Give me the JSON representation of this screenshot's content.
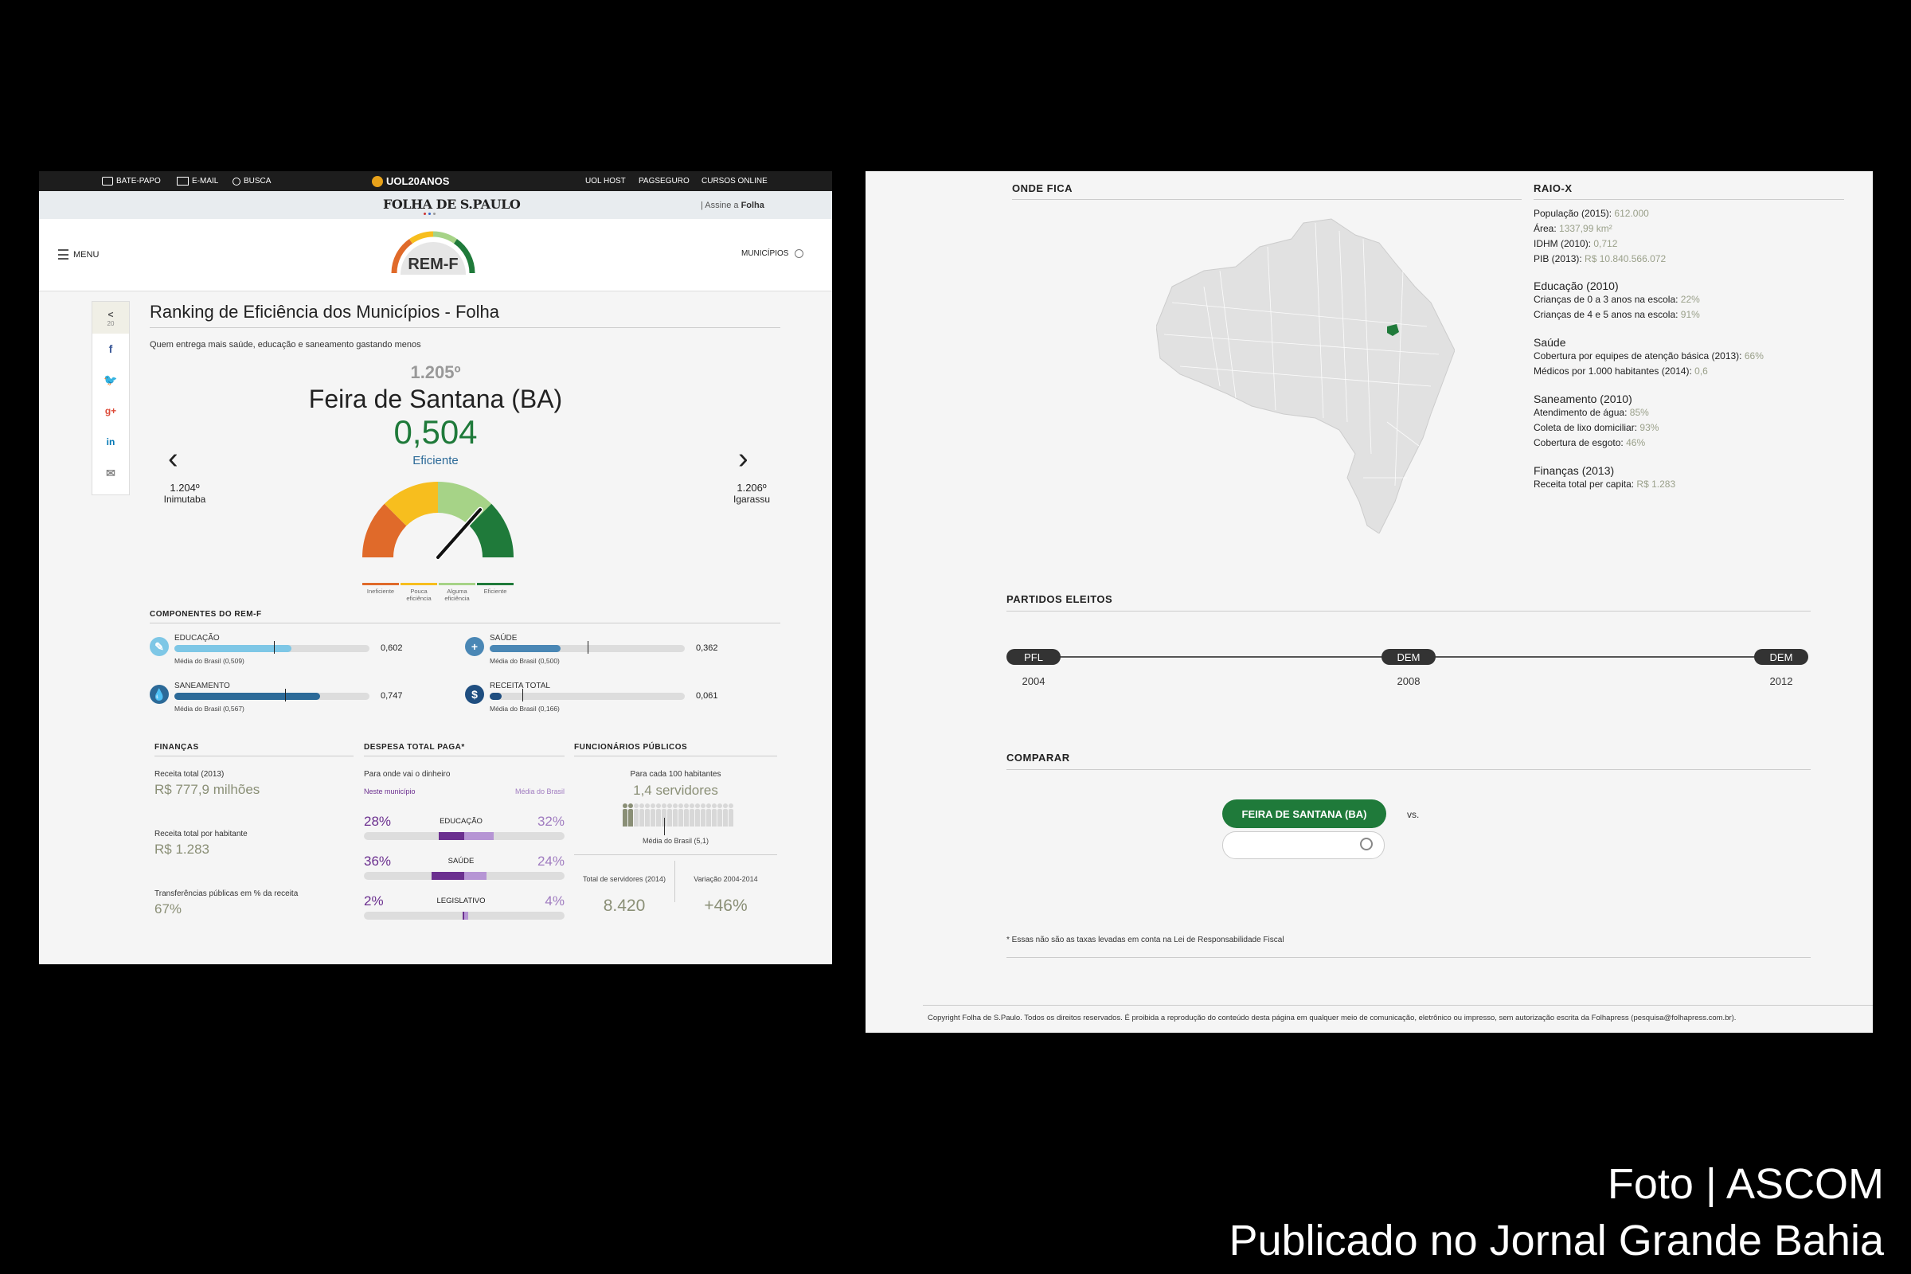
{
  "left": {
    "topbar": {
      "batepapo": "BATE-PAPO",
      "email": "E-MAIL",
      "busca": "BUSCA",
      "logo": "UOL20ANOS",
      "uolhost": "UOL HOST",
      "pagseguro": "PAGSEGURO",
      "cursos": "CURSOS ONLINE"
    },
    "folha": {
      "title": "FOLHA DE S.PAULO",
      "assine_prefix": "| Assine a",
      "assine_brand": "Folha"
    },
    "nav": {
      "menu": "MENU",
      "logo": "REM-F",
      "municipios": "MUNICÍPIOS"
    },
    "share": {
      "count": "20"
    },
    "header": {
      "title": "Ranking de Eficiência dos Municípios - Folha",
      "subtitle": "Quem entrega mais saúde, educação e saneamento gastando menos"
    },
    "city": {
      "rank": "1.205º",
      "name": "Feira de Santana (BA)",
      "score": "0,504",
      "status": "Eficiente",
      "gauge_value": 0.504,
      "prev_rank": "1.204º",
      "prev_name": "Inimutaba",
      "next_rank": "1.206º",
      "next_name": "Igarassu"
    },
    "gauge_legend": [
      {
        "label": "Ineficiente",
        "color": "#e06a2a"
      },
      {
        "label": "Pouca eficiência",
        "color": "#f7be1e"
      },
      {
        "label": "Alguma eficiência",
        "color": "#a6d387"
      },
      {
        "label": "Eficiente",
        "color": "#1f7a3a"
      }
    ],
    "components": {
      "title": "COMPONENTES DO REM-F",
      "items": [
        {
          "label": "EDUCAÇÃO",
          "value": "0,602",
          "avg": "Média do Brasil (0,509)",
          "fill": 0.602,
          "avg_pos": 0.509,
          "color": "#7ec7e6",
          "icon_color": "#7ec7e6",
          "icon": "✎"
        },
        {
          "label": "SAÚDE",
          "value": "0,362",
          "avg": "Média do Brasil (0,500)",
          "fill": 0.362,
          "avg_pos": 0.5,
          "color": "#4a87b5",
          "icon_color": "#4a87b5",
          "icon": "+"
        },
        {
          "label": "SANEAMENTO",
          "value": "0,747",
          "avg": "Média do Brasil (0,567)",
          "fill": 0.747,
          "avg_pos": 0.567,
          "color": "#2c6a98",
          "icon_color": "#2c6a98",
          "icon": "💧"
        },
        {
          "label": "RECEITA TOTAL",
          "value": "0,061",
          "avg": "Média do Brasil (0,166)",
          "fill": 0.061,
          "avg_pos": 0.166,
          "color": "#1f4e80",
          "icon_color": "#1f4e80",
          "icon": "$"
        }
      ]
    },
    "financas": {
      "title": "FINANÇAS",
      "items": [
        {
          "label": "Receita total (2013)",
          "value": "R$ 777,9 milhões"
        },
        {
          "label": "Receita total por habitante",
          "value": "R$ 1.283"
        },
        {
          "label": "Transferências públicas em % da receita",
          "value": "67%"
        }
      ]
    },
    "despesa": {
      "title": "DESPESA TOTAL PAGA*",
      "subtitle": "Para onde vai o dinheiro",
      "neste": "Neste município",
      "media": "Média do Brasil",
      "items": [
        {
          "label": "EDUCAÇÃO",
          "local": "28%",
          "brasil": "32%",
          "local_val": 0.28,
          "brasil_val": 0.32
        },
        {
          "label": "SAÚDE",
          "local": "36%",
          "brasil": "24%",
          "local_val": 0.36,
          "brasil_val": 0.24
        },
        {
          "label": "LEGISLATIVO",
          "local": "2%",
          "brasil": "4%",
          "local_val": 0.02,
          "brasil_val": 0.04
        }
      ]
    },
    "funcionarios": {
      "title": "FUNCIONÁRIOS PÚBLICOS",
      "subtitle": "Para cada 100 habitantes",
      "value": "1,4 servidores",
      "media": "Média do Brasil (5,1)",
      "total_label": "Total de servidores (2014)",
      "total_value": "8.420",
      "var_label": "Variação 2004-2014",
      "var_value": "+46%"
    }
  },
  "right": {
    "onde_fica": "ONDE FICA",
    "raio_x": {
      "title": "RAIO-X",
      "lines1": [
        {
          "label": "População (2015):",
          "value": "612.000"
        },
        {
          "label": "Área:",
          "value": "1337,99 km²"
        },
        {
          "label": "IDHM (2010):",
          "value": "0,712"
        },
        {
          "label": "PIB (2013):",
          "value": "R$ 10.840.566.072"
        }
      ],
      "educacao_title": "Educação (2010)",
      "educacao": [
        {
          "label": "Crianças de 0 a 3 anos na escola:",
          "value": "22%"
        },
        {
          "label": "Crianças de 4 e 5 anos na escola:",
          "value": "91%"
        }
      ],
      "saude_title": "Saúde",
      "saude": [
        {
          "label": "Cobertura por equipes de atenção básica (2013):",
          "value": "66%"
        },
        {
          "label": "Médicos por 1.000 habitantes (2014):",
          "value": "0,6"
        }
      ],
      "saneamento_title": "Saneamento (2010)",
      "saneamento": [
        {
          "label": "Atendimento de água:",
          "value": "85%"
        },
        {
          "label": "Coleta de lixo domiciliar:",
          "value": "93%"
        },
        {
          "label": "Cobertura de esgoto:",
          "value": "46%"
        }
      ],
      "financas_title": "Finanças (2013)",
      "financas": [
        {
          "label": "Receita total per capita:",
          "value": "R$ 1.283"
        }
      ]
    },
    "partidos": {
      "title": "PARTIDOS ELEITOS",
      "items": [
        {
          "party": "PFL",
          "year": "2004"
        },
        {
          "party": "DEM",
          "year": "2008"
        },
        {
          "party": "DEM",
          "year": "2012"
        }
      ]
    },
    "comparar": {
      "title": "COMPARAR",
      "city_button": "FEIRA DE SANTANA (BA)",
      "vs": "vs.",
      "search_placeholder": ""
    },
    "footnote": "* Essas não são as taxas levadas em conta na Lei de Responsabilidade Fiscal",
    "copyright": "Copyright Folha de S.Paulo. Todos os direitos reservados. É proibida a reprodução do conteúdo desta página em qualquer meio de comunicação, eletrônico ou impresso, sem autorização escrita da Folhapress (pesquisa@folhapress.com.br)."
  },
  "caption": {
    "line1": "Foto | ASCOM",
    "line2": "Publicado no Jornal Grande Bahia"
  }
}
